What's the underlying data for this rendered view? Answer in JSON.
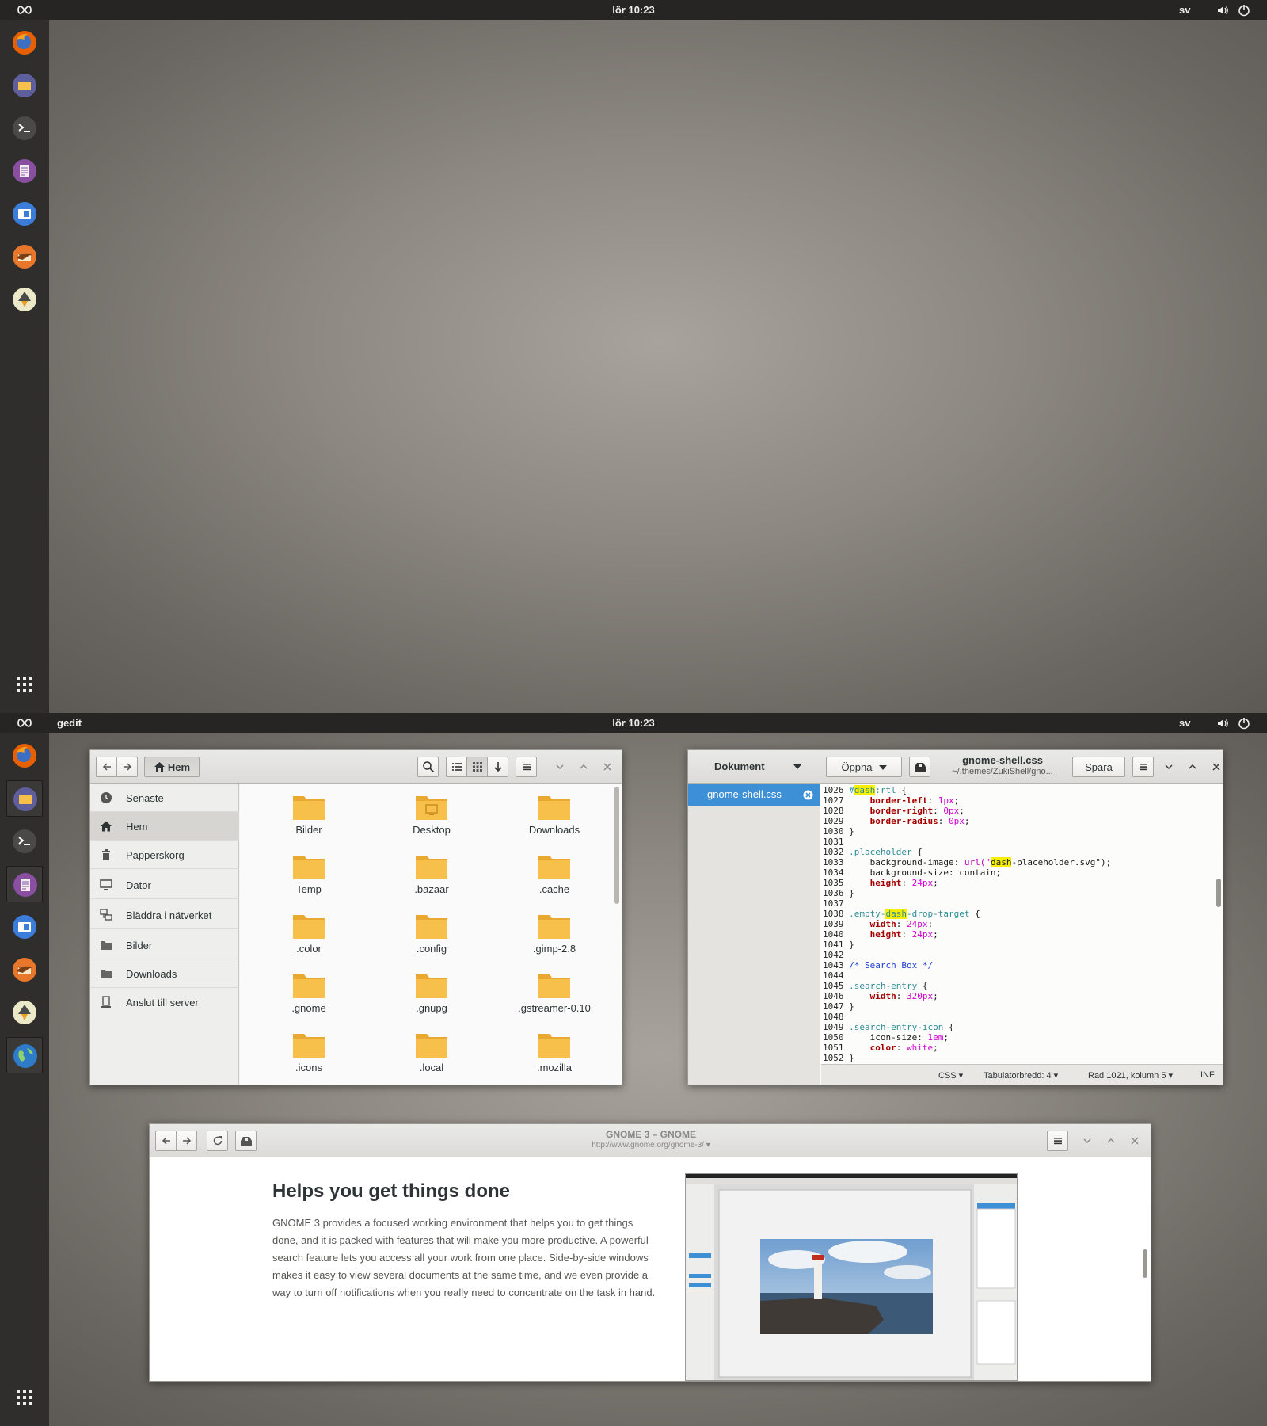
{
  "topbar": {
    "clock": "lör 10:23",
    "language": "sv",
    "focused_app": "gedit"
  },
  "dash": {
    "apps": [
      "firefox-icon",
      "files-icon",
      "terminal-icon",
      "text-editor-icon",
      "virtualbox-icon",
      "thunderbird-icon",
      "inkscape-icon"
    ],
    "bottom_extra_app": "web-browser-icon"
  },
  "files": {
    "location_button": "Hem",
    "sidebar": [
      "Senaste",
      "Hem",
      "Papperskorg",
      "Dator",
      "Bläddra i nätverket",
      "Bilder",
      "Downloads",
      "Anslut till server"
    ],
    "folders": [
      "Bilder",
      "Desktop",
      "Downloads",
      "Temp",
      ".bazaar",
      ".cache",
      ".color",
      ".config",
      ".gimp-2.8",
      ".gnome",
      ".gnupg",
      ".gstreamer-0.10",
      ".icons",
      ".local",
      ".mozilla"
    ]
  },
  "gedit": {
    "sidebar_title": "Dokument",
    "open_button": "Öppna",
    "title": "gnome-shell.css",
    "subtitle": "~/.themes/ZukiShell/gno...",
    "save_button": "Spara",
    "document": "gnome-shell.css",
    "code_lines": [
      [
        {
          "t": "1026 ",
          "c": "ln"
        },
        {
          "t": "#",
          "c": "sel"
        },
        {
          "t": "dash",
          "c": "sel hl"
        },
        {
          "t": ":rtl",
          "c": "sel"
        },
        {
          "t": " {",
          "c": ""
        }
      ],
      [
        {
          "t": "1027 ",
          "c": "ln"
        },
        {
          "t": "    ",
          "c": ""
        },
        {
          "t": "border-left",
          "c": "prop"
        },
        {
          "t": ": ",
          "c": ""
        },
        {
          "t": "1px",
          "c": "num"
        },
        {
          "t": ";",
          "c": ""
        }
      ],
      [
        {
          "t": "1028 ",
          "c": "ln"
        },
        {
          "t": "    ",
          "c": ""
        },
        {
          "t": "border-right",
          "c": "prop"
        },
        {
          "t": ": ",
          "c": ""
        },
        {
          "t": "0px",
          "c": "num"
        },
        {
          "t": ";",
          "c": ""
        }
      ],
      [
        {
          "t": "1029 ",
          "c": "ln"
        },
        {
          "t": "    ",
          "c": ""
        },
        {
          "t": "border-radius",
          "c": "prop"
        },
        {
          "t": ": ",
          "c": ""
        },
        {
          "t": "0px",
          "c": "num"
        },
        {
          "t": ";",
          "c": ""
        }
      ],
      [
        {
          "t": "1030 ",
          "c": "ln"
        },
        {
          "t": "}",
          "c": ""
        }
      ],
      [
        {
          "t": "1031",
          "c": "ln"
        }
      ],
      [
        {
          "t": "1032 ",
          "c": "ln"
        },
        {
          "t": ".placeholder",
          "c": "sel"
        },
        {
          "t": " {",
          "c": ""
        }
      ],
      [
        {
          "t": "1033 ",
          "c": "ln"
        },
        {
          "t": "    background-image: ",
          "c": ""
        },
        {
          "t": "url(\"",
          "c": "str"
        },
        {
          "t": "dash",
          "c": "hl"
        },
        {
          "t": "-placeholder.svg\");",
          "c": ""
        }
      ],
      [
        {
          "t": "1034 ",
          "c": "ln"
        },
        {
          "t": "    background-size: contain;",
          "c": ""
        }
      ],
      [
        {
          "t": "1035 ",
          "c": "ln"
        },
        {
          "t": "    ",
          "c": ""
        },
        {
          "t": "height",
          "c": "prop"
        },
        {
          "t": ": ",
          "c": ""
        },
        {
          "t": "24px",
          "c": "num"
        },
        {
          "t": ";",
          "c": ""
        }
      ],
      [
        {
          "t": "1036 ",
          "c": "ln"
        },
        {
          "t": "}",
          "c": ""
        }
      ],
      [
        {
          "t": "1037",
          "c": "ln"
        }
      ],
      [
        {
          "t": "1038 ",
          "c": "ln"
        },
        {
          "t": ".empty-",
          "c": "sel"
        },
        {
          "t": "dash",
          "c": "sel hl"
        },
        {
          "t": "-drop-target",
          "c": "sel"
        },
        {
          "t": " {",
          "c": ""
        }
      ],
      [
        {
          "t": "1039 ",
          "c": "ln"
        },
        {
          "t": "    ",
          "c": ""
        },
        {
          "t": "width",
          "c": "prop"
        },
        {
          "t": ": ",
          "c": ""
        },
        {
          "t": "24px",
          "c": "num"
        },
        {
          "t": ";",
          "c": ""
        }
      ],
      [
        {
          "t": "1040 ",
          "c": "ln"
        },
        {
          "t": "    ",
          "c": ""
        },
        {
          "t": "height",
          "c": "prop"
        },
        {
          "t": ": ",
          "c": ""
        },
        {
          "t": "24px",
          "c": "num"
        },
        {
          "t": ";",
          "c": ""
        }
      ],
      [
        {
          "t": "1041 ",
          "c": "ln"
        },
        {
          "t": "}",
          "c": ""
        }
      ],
      [
        {
          "t": "1042",
          "c": "ln"
        }
      ],
      [
        {
          "t": "1043 ",
          "c": "ln"
        },
        {
          "t": "/* Search Box */",
          "c": "cmt"
        }
      ],
      [
        {
          "t": "1044",
          "c": "ln"
        }
      ],
      [
        {
          "t": "1045 ",
          "c": "ln"
        },
        {
          "t": ".search-entry",
          "c": "sel"
        },
        {
          "t": " {",
          "c": ""
        }
      ],
      [
        {
          "t": "1046 ",
          "c": "ln"
        },
        {
          "t": "    ",
          "c": ""
        },
        {
          "t": "width",
          "c": "prop"
        },
        {
          "t": ": ",
          "c": ""
        },
        {
          "t": "320px",
          "c": "num"
        },
        {
          "t": ";",
          "c": ""
        }
      ],
      [
        {
          "t": "1047 ",
          "c": "ln"
        },
        {
          "t": "}",
          "c": ""
        }
      ],
      [
        {
          "t": "1048",
          "c": "ln"
        }
      ],
      [
        {
          "t": "1049 ",
          "c": "ln"
        },
        {
          "t": ".search-entry-icon",
          "c": "sel"
        },
        {
          "t": " {",
          "c": ""
        }
      ],
      [
        {
          "t": "1050 ",
          "c": "ln"
        },
        {
          "t": "    icon-size: ",
          "c": ""
        },
        {
          "t": "1em",
          "c": "num"
        },
        {
          "t": ";",
          "c": ""
        }
      ],
      [
        {
          "t": "1051 ",
          "c": "ln"
        },
        {
          "t": "    ",
          "c": ""
        },
        {
          "t": "color",
          "c": "prop"
        },
        {
          "t": ": ",
          "c": ""
        },
        {
          "t": "white",
          "c": "num"
        },
        {
          "t": ";",
          "c": ""
        }
      ],
      [
        {
          "t": "1052 ",
          "c": "ln"
        },
        {
          "t": "}",
          "c": ""
        }
      ]
    ],
    "status": {
      "language": "CSS",
      "tab_width": "Tabulatorbredd: 4",
      "position": "Rad 1021, kolumn 5",
      "mode": "INF"
    }
  },
  "web": {
    "title": "GNOME 3 – GNOME",
    "url": "http://www.gnome.org/gnome-3/ ▾",
    "heading": "Helps you get things done",
    "paragraph": "GNOME 3 provides a focused working environment that helps you to get things done, and it is packed with features that will make you more productive. A powerful search feature lets you access all your work from one place. Side-by-side windows makes it easy to view several documents at the same time, and we even provide a way to turn off notifications when you really need to concentrate on the task in hand."
  },
  "colors": {
    "topbar": "#262524",
    "dash": "#2f2e2d",
    "accent": "#3d8fd6",
    "folder": "#f7c04a"
  }
}
